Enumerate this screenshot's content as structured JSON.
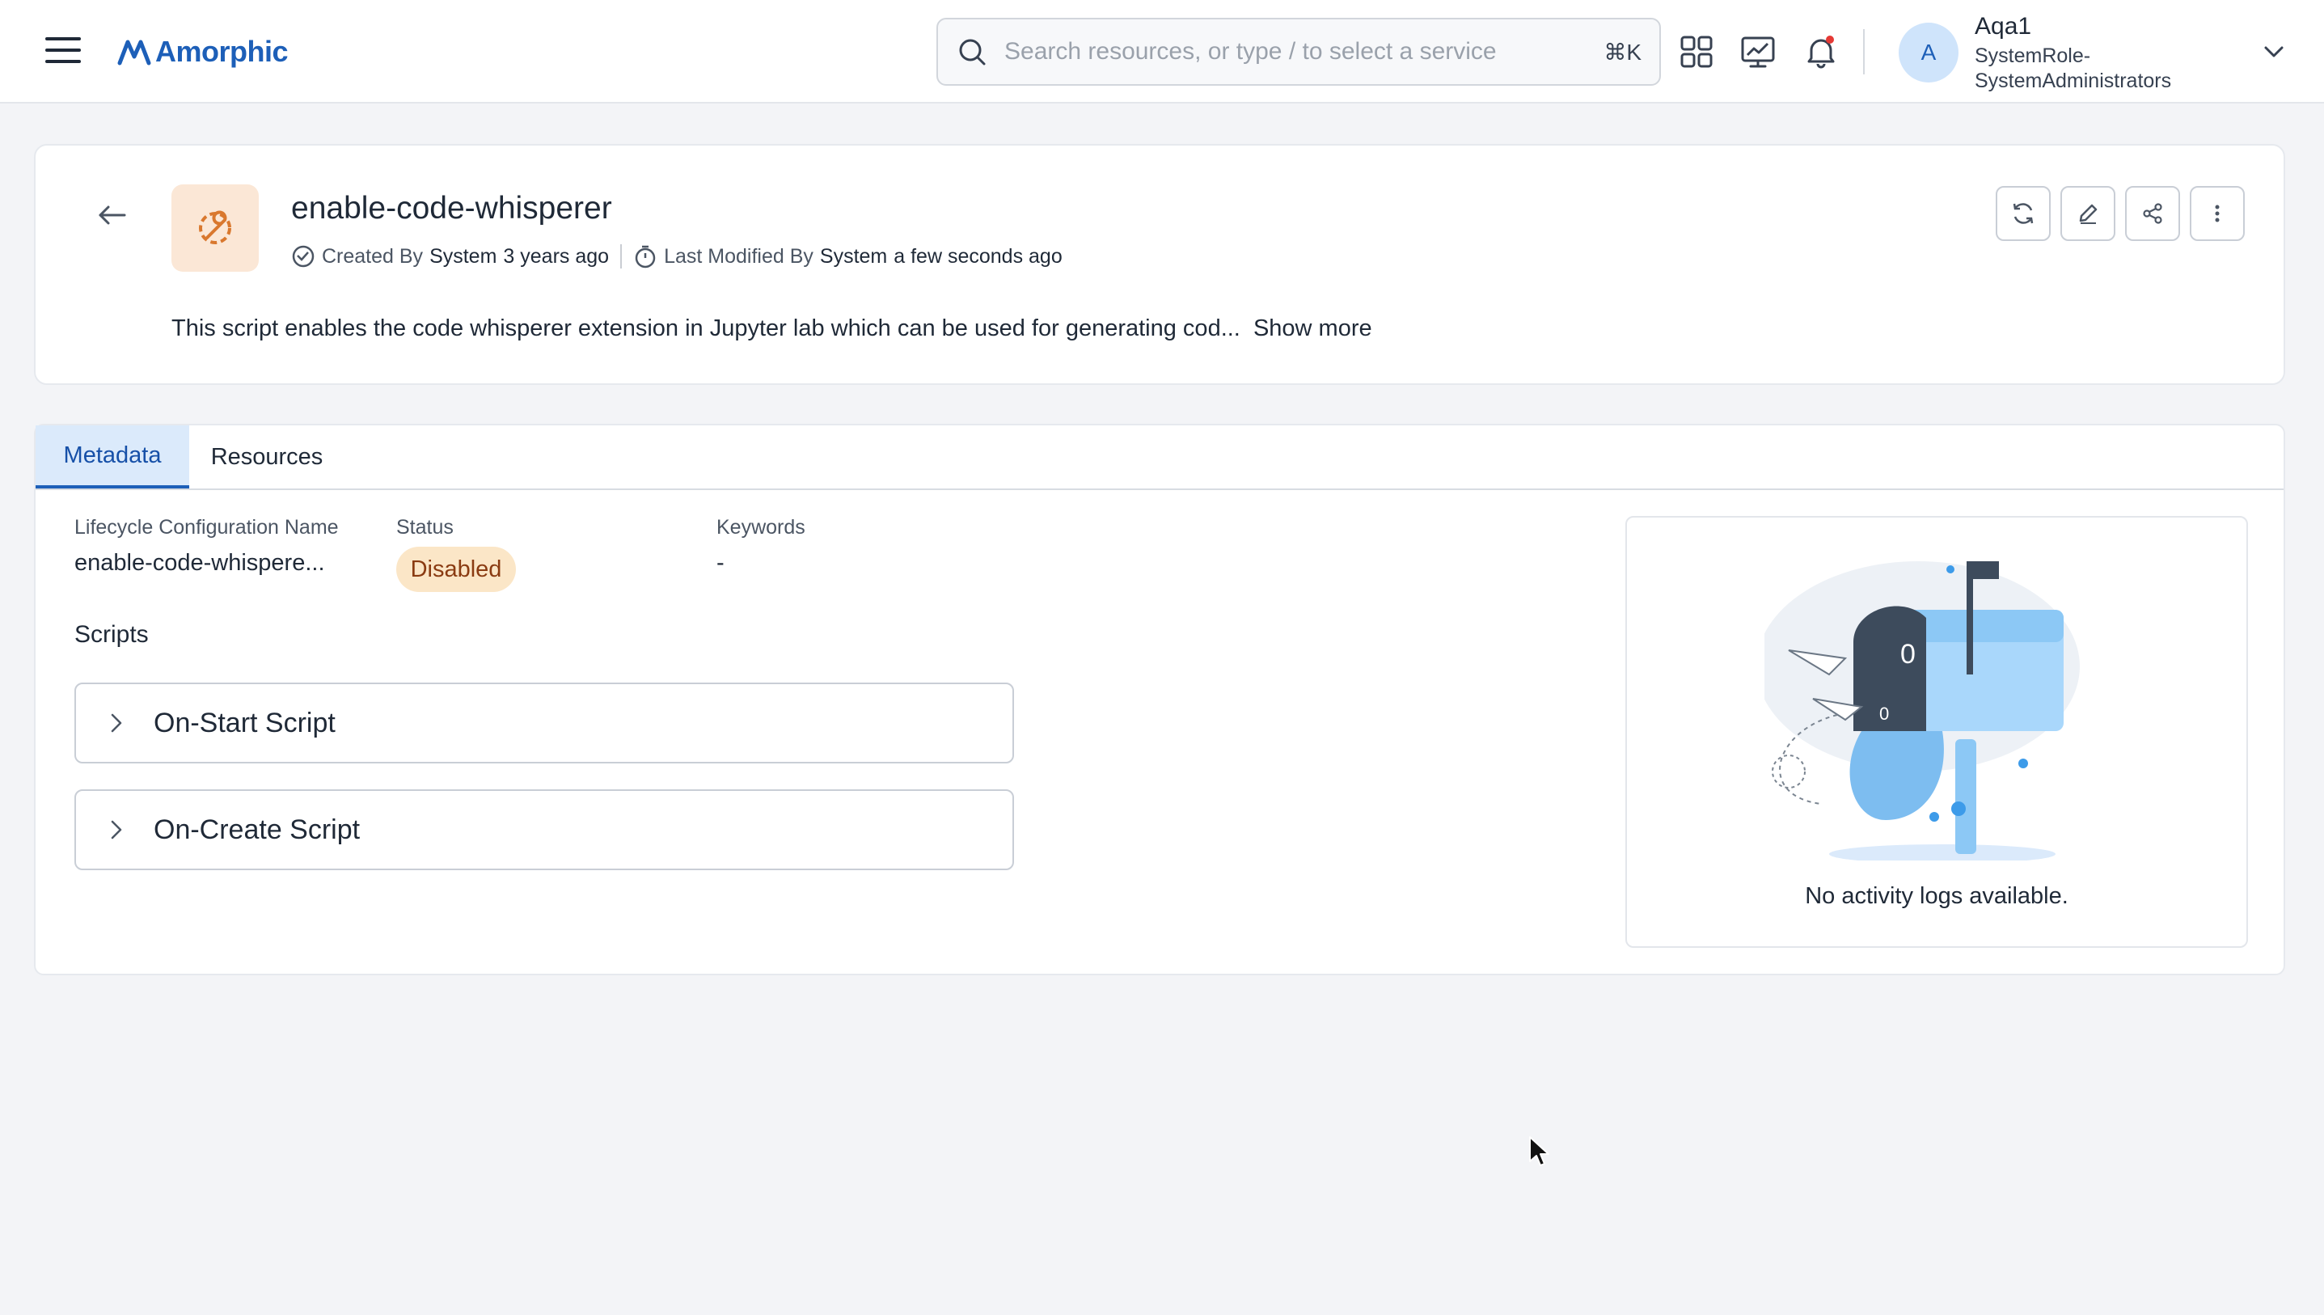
{
  "app": {
    "brand": "Amorphic",
    "accent_color": "#1d5fb8"
  },
  "search": {
    "placeholder": "Search resources, or type / to select a service",
    "shortcut": "⌘K"
  },
  "topbar_icons": [
    "apps-grid-icon",
    "dashboard-chart-icon",
    "notification-bell-icon"
  ],
  "user": {
    "avatar_initial": "A",
    "name": "Aqa1",
    "role": "SystemRole-SystemAdministrators"
  },
  "header": {
    "title": "enable-code-whisperer",
    "created_label": "Created By",
    "created_by": "System",
    "created_when": "3 years ago",
    "modified_label": "Last Modified By",
    "modified_by": "System",
    "modified_when": "a few seconds ago",
    "description": "This script enables the code whisperer extension in Jupyter lab which can be used for generating cod...",
    "show_more": "Show more",
    "actions": [
      "refresh-icon",
      "edit-icon",
      "share-icon",
      "more-options-icon"
    ]
  },
  "tabs": [
    {
      "label": "Metadata",
      "active": true
    },
    {
      "label": "Resources",
      "active": false
    }
  ],
  "metadata": {
    "name_label": "Lifecycle Configuration Name",
    "name_value": "enable-code-whispere...",
    "status_label": "Status",
    "status_value": "Disabled",
    "status_color": "#fbe6c7",
    "keywords_label": "Keywords",
    "keywords_value": "-",
    "scripts_label": "Scripts",
    "scripts": [
      {
        "label": "On-Start Script"
      },
      {
        "label": "On-Create Script"
      }
    ]
  },
  "activity": {
    "empty_text": "No activity logs available.",
    "mailbox_counts": [
      "0",
      "0"
    ]
  }
}
